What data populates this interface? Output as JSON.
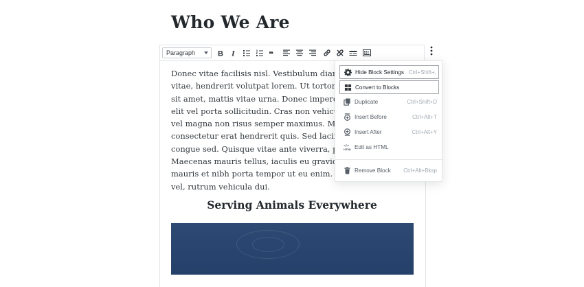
{
  "page": {
    "title": "Who We Are"
  },
  "toolbar": {
    "block_type": "Paragraph",
    "buttons": [
      {
        "name": "bold-icon",
        "glyph": "B"
      },
      {
        "name": "italic-icon",
        "glyph": "I"
      },
      {
        "name": "bulleted-list-icon"
      },
      {
        "name": "numbered-list-icon"
      },
      {
        "name": "quote-icon",
        "glyph": "❝"
      },
      {
        "name": "align-left-icon"
      },
      {
        "name": "align-center-icon"
      },
      {
        "name": "align-right-icon"
      },
      {
        "name": "link-icon"
      },
      {
        "name": "unlink-icon"
      },
      {
        "name": "more-horizontal-icon"
      },
      {
        "name": "toolbar-toggle-icon"
      }
    ]
  },
  "paragraph": {
    "lines": [
      "Donec vitae facilisis nisl. Vestibulum diam magna, v",
      "vitae, hendrerit volutpat lorem. Ut tortor quam, sce",
      "sit amet, mattis vitae urna. Donec imperdiet tincidu",
      "elit vel porta sollicitudin. Cras non vehicula magna.",
      "vel magna non risus semper maximus. Mauris rutru",
      "consectetur erat hendrerit quis. Sed lacinia tortor n",
      "congue sed. Quisque vitae ante viverra, pharetra ris",
      "Maecenas mauris tellus, iaculis eu gravida vel, moll",
      "mauris et nibh porta tempor ut eu enim. Cras felis t",
      "vel, rutrum vehicula dui."
    ]
  },
  "subheading": "Serving Animals Everywhere",
  "menu": {
    "items": [
      {
        "label": "Hide Block Settings",
        "shortcut": "Ctrl+Shift+,",
        "icon": "gear-icon",
        "active": true
      },
      {
        "label": "Convert to Blocks",
        "shortcut": "",
        "icon": "grid-blocks-icon",
        "active": true
      },
      {
        "label": "Duplicate",
        "shortcut": "Ctrl+Shift+D",
        "icon": "duplicate-icon",
        "active": false
      },
      {
        "label": "Insert Before",
        "shortcut": "Ctrl+Alt+T",
        "icon": "insert-before-icon",
        "active": false
      },
      {
        "label": "Insert After",
        "shortcut": "Ctrl+Alt+Y",
        "icon": "insert-after-icon",
        "active": false
      },
      {
        "label": "Edit as HTML",
        "shortcut": "",
        "icon": "html-icon",
        "active": false
      },
      {
        "label": "Remove Block",
        "shortcut": "Ctrl+Alt+Bksp",
        "icon": "trash-icon",
        "active": false
      }
    ]
  }
}
